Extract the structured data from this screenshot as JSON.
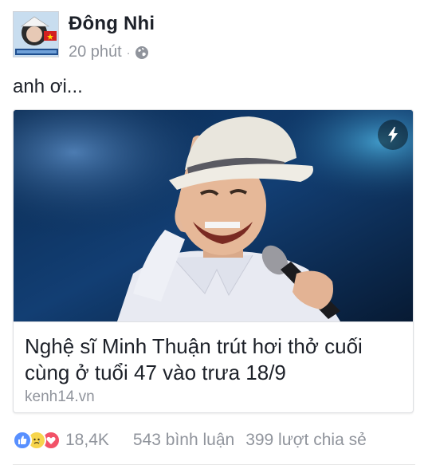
{
  "post": {
    "author": "Đông Nhi",
    "timestamp": "20 phút",
    "separator": "·",
    "privacy_icon": "globe-icon",
    "text": "anh ơi..."
  },
  "link_card": {
    "title": "Nghệ sĩ Minh Thuận trút hơi thở cuối cùng ở tuổi 47 vào trưa 18/9",
    "domain": "kenh14.vn",
    "badge_icon": "lightning-icon"
  },
  "engagement": {
    "reaction_icons": [
      "like-icon",
      "sad-icon",
      "love-icon"
    ],
    "reaction_count": "18,4K",
    "comments": "543 bình luận",
    "shares": "399 lượt chia sẻ"
  },
  "colors": {
    "like": "#5890ff",
    "sad": "#f7d54c",
    "love": "#f25268",
    "meta_gray": "#90949c"
  }
}
